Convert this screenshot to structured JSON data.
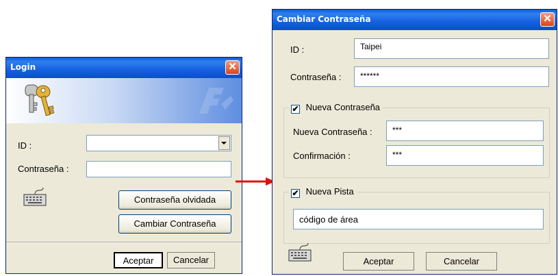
{
  "login": {
    "title": "Login",
    "close_glyph": "✕",
    "id_label": "ID :",
    "id_value": "",
    "password_label": "Contraseña :",
    "password_value": "",
    "forgot_button": "Contraseña olvidada",
    "change_button": "Cambiar Contraseña",
    "ok_button": "Aceptar",
    "cancel_button": "Cancelar",
    "icons": [
      "keys-icon",
      "keyboard-icon",
      "dropdown-arrow-icon"
    ]
  },
  "change": {
    "title": "Cambiar Contraseña",
    "close_glyph": "✕",
    "id_label": "ID :",
    "id_value": "Taipei",
    "password_label": "Contraseña :",
    "password_value": "******",
    "new_password_group": {
      "checked": true,
      "check_glyph": "✔",
      "label": "Nueva Contraseña",
      "new_label": "Nueva Contraseña :",
      "new_value": "***",
      "confirm_label": "Confirmación :",
      "confirm_value": "***"
    },
    "hint_group": {
      "checked": true,
      "check_glyph": "✔",
      "label": "Nueva Pista",
      "value": "código de área"
    },
    "ok_button": "Aceptar",
    "cancel_button": "Cancelar"
  },
  "colors": {
    "titlebar": "#0a5fd8",
    "arrow": "#e01010",
    "window_bg": "#ece9d8"
  }
}
